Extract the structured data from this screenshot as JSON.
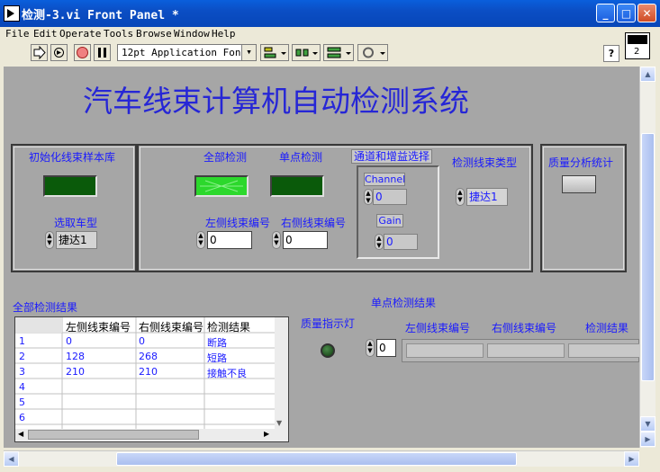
{
  "window": {
    "title": "检测-3.vi Front Panel *"
  },
  "menu": [
    "File",
    "Edit",
    "Operate",
    "Tools",
    "Browse",
    "Window",
    "Help"
  ],
  "toolbar": {
    "font": "12pt Application Font",
    "help": "?",
    "connector_label": "2"
  },
  "panel": {
    "title": "汽车线束计算机自动检测系统",
    "init_section": {
      "label": "初始化线束样本库",
      "car_model_label": "选取车型",
      "car_model_value": "捷达1"
    },
    "test_section": {
      "full_test_label": "全部检测",
      "single_test_label": "单点检测",
      "left_harness_label": "左侧线束编号",
      "left_harness_value": "0",
      "right_harness_label": "右侧线束编号",
      "right_harness_value": "0",
      "channel_gain_label": "通道和增益选择",
      "channel_label": "Channel",
      "channel_value": "0",
      "gain_label": "Gain",
      "gain_value": "0",
      "harness_type_label": "检测线束类型",
      "harness_type_value": "捷达1"
    },
    "quality_section": {
      "label": "质量分析统计"
    },
    "full_results": {
      "label": "全部检测结果",
      "columns": [
        "左侧线束编号",
        "右侧线束编号",
        "检测结果"
      ],
      "row_headers": [
        "1",
        "2",
        "3",
        "4",
        "5",
        "6"
      ],
      "rows": [
        [
          "0",
          "0",
          "断路"
        ],
        [
          "128",
          "268",
          "短路"
        ],
        [
          "210",
          "210",
          "接触不良"
        ],
        [
          "",
          "",
          ""
        ],
        [
          "",
          "",
          ""
        ],
        [
          "",
          "",
          ""
        ]
      ]
    },
    "quality_indicator_label": "质量指示灯",
    "single_results": {
      "label": "单点检测结果",
      "index_value": "0",
      "columns": [
        "左侧线束编号",
        "右侧线束编号",
        "检测结果"
      ]
    }
  }
}
